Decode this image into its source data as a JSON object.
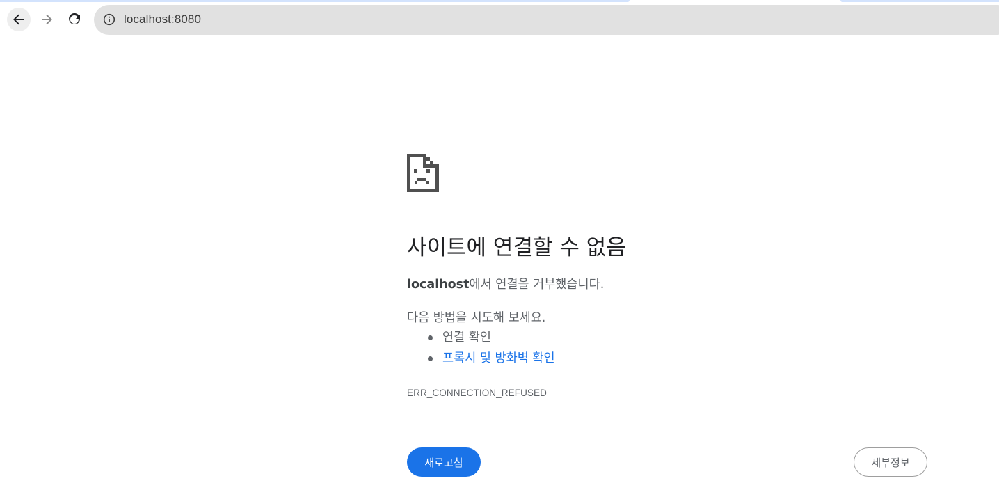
{
  "browser": {
    "url": "localhost:8080",
    "icons": {
      "back": "arrow-left-icon",
      "forward": "arrow-right-icon",
      "reload": "reload-icon",
      "site_info": "info-icon"
    }
  },
  "error_page": {
    "icon": "sad-document-icon",
    "heading": "사이트에 연결할 수 없음",
    "summary_host": "localhost",
    "summary_rest": "에서 연결을 거부했습니다.",
    "suggestions_title": "다음 방법을 시도해 보세요.",
    "suggestions": [
      {
        "label": "연결 확인"
      },
      {
        "label": "프록시 및 방화벽 확인"
      }
    ],
    "error_code": "ERR_CONNECTION_REFUSED",
    "reload_label": "새로고침",
    "details_label": "세부정보",
    "colors": {
      "accent": "#1a73e8",
      "text": "#5f6368",
      "heading": "#202124"
    }
  }
}
